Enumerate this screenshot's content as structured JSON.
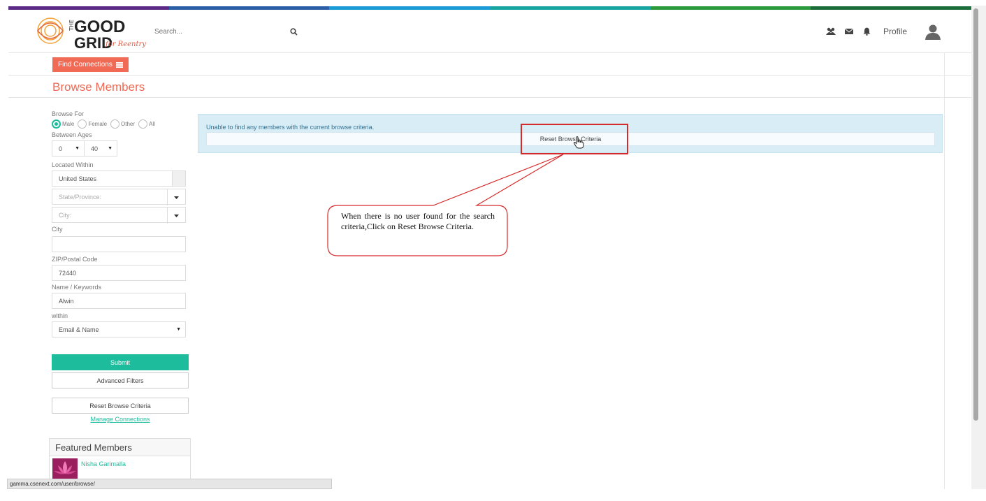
{
  "colors": {
    "accent_red": "#f16a55",
    "accent_green": "#1cbc9c",
    "stripe": [
      "#5b2a86",
      "#2a5fa8",
      "#1a9ad6",
      "#16a5a1",
      "#2a9a3d",
      "#1b6e3a"
    ]
  },
  "header": {
    "logo_text_top": "GOOD",
    "logo_text_bottom": "GRID",
    "logo_script": "for Reentry",
    "search_placeholder": "Search...",
    "search_icon": "search-icon",
    "profile_label": "Profile"
  },
  "subbar": {
    "find_connections_label": "Find Connections"
  },
  "page": {
    "title": "Browse Members"
  },
  "sidebar": {
    "browse_for_label": "Browse For",
    "gender_options": [
      {
        "label": "Male",
        "checked": true
      },
      {
        "label": "Female",
        "checked": false
      },
      {
        "label": "Other",
        "checked": false
      },
      {
        "label": "All",
        "checked": false
      }
    ],
    "between_ages_label": "Between Ages",
    "age_min": "0",
    "age_max": "40",
    "located_within_label": "Located Within",
    "country_value": "United States",
    "state_placeholder": "State/Province:",
    "city_placeholder": "City:",
    "city_label": "City",
    "city_value": "",
    "zip_label": "ZIP/Postal Code",
    "zip_value": "72440",
    "name_keywords_label": "Name / Keywords",
    "name_keywords_value": "Alwin",
    "within_label": "within",
    "within_value": "Email & Name",
    "submit_label": "Submit",
    "advanced_filters_label": "Advanced Filters",
    "reset_label": "Reset Browse Criteria",
    "manage_connections_label": "Manage Connections"
  },
  "featured": {
    "heading": "Featured Members",
    "members": [
      {
        "name": "Nisha Garimalla"
      }
    ]
  },
  "results": {
    "message": "Unable to find any members with the current browse criteria.",
    "reset_button_label": "Reset Browse Criteria"
  },
  "annotation": {
    "callout_text": "When there is no user found for the search criteria,Click on Reset Browse Criteria."
  },
  "statusbar": {
    "url": "gamma.csenext.com/user/browse/"
  }
}
